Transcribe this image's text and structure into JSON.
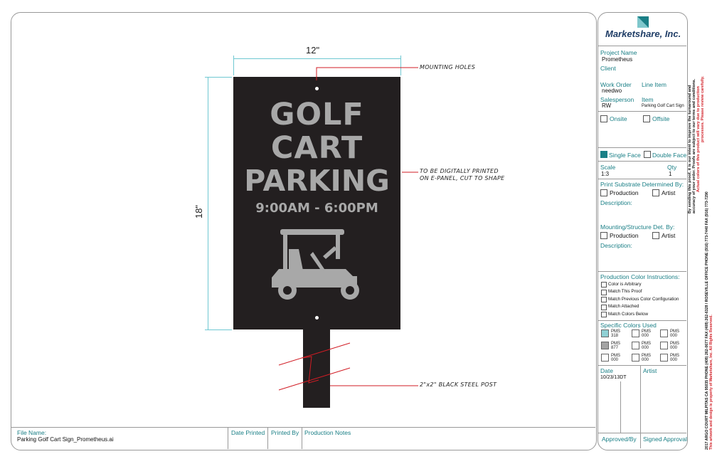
{
  "dimensions": {
    "width": "12\"",
    "height": "18\""
  },
  "sign": {
    "line1": "GOLF",
    "line2": "CART",
    "line3": "PARKING",
    "hours": "9:00AM - 6:00PM"
  },
  "callouts": {
    "mounting": "MOUNTING HOLES",
    "print_line1": "TO BE DIGITALLY PRINTED",
    "print_line2": "ON E-PANEL, CUT TO SHAPE",
    "post": "2\"x2\" BLACK STEEL POST"
  },
  "footer": {
    "file_name_label": "File Name:",
    "file_name": "Parking Golf Cart Sign_Prometheus.ai",
    "date_printed_label": "Date Printed",
    "printed_by_label": "Printed By",
    "production_notes_label": "Production Notes"
  },
  "titleblock": {
    "company": "Marketshare, Inc.",
    "project_name_label": "Project Name",
    "project_name": "Prometheus",
    "client_label": "Client",
    "work_order_label": "Work Order",
    "work_order": "needwo",
    "line_item_label": "Line Item",
    "salesperson_label": "Salesperson",
    "salesperson": "RW",
    "item_label": "Item",
    "item": "Parking Golf Cart Sign",
    "onsite_label": "Onsite",
    "offsite_label": "Offsite",
    "single_face_label": "Single Face",
    "double_face_label": "Double Face",
    "scale_label": "Scale",
    "scale": "1:3",
    "qty_label": "Qty",
    "qty": "1",
    "substrate_label": "Print Substrate Determined By:",
    "production_label": "Production",
    "artist_label": "Artist",
    "description_label": "Description:",
    "mounting_label": "Mounting/Structure Det. By:",
    "color_instructions_label": "Production Color Instructions:",
    "color_options": [
      "Color is Arbitrary",
      "Match This Proof",
      "Match Previous Color Configuration",
      "Match Attached",
      "Match Colors Below"
    ],
    "specific_colors_label": "Specific Colors Used",
    "pms": [
      {
        "label": "PMS",
        "code": "318",
        "color": "#8fd0d4"
      },
      {
        "label": "PMS",
        "code": "000",
        "color": "#ffffff"
      },
      {
        "label": "PMS",
        "code": "000",
        "color": "#ffffff"
      },
      {
        "label": "PMS",
        "code": "877",
        "color": "#a4a4a4"
      },
      {
        "label": "PMS",
        "code": "000",
        "color": "#ffffff"
      },
      {
        "label": "PMS",
        "code": "000",
        "color": "#ffffff"
      },
      {
        "label": "PMS",
        "code": "000",
        "color": "#ffffff"
      },
      {
        "label": "PMS",
        "code": "000",
        "color": "#ffffff"
      },
      {
        "label": "PMS",
        "code": "000",
        "color": "#ffffff"
      }
    ],
    "date_label": "Date",
    "date": "10/23/13DT",
    "artist_col_label": "Artist",
    "approved_by_label": "Approved/By",
    "signed_approval_label": "Signed Approval"
  },
  "side_text": {
    "black1": "By sending this proof, it is our intent to improve the turnaround and",
    "black2": "accuracy of your order. Proofs are subject to our terms and conditions.",
    "red1": "Actual colors of this product will vary due to production",
    "red2": "processes. Please review carefully.",
    "black3": "2017 ARGO COURT MILPITAS CA 95035  PHONE (408) 262-0677  FAX (408) 262-6328 / ROSEVILLE OFFICE  PHONE (916) 773-7440  FAX (916) 773-7290",
    "red3": "This artwork and design is property of Marketshare, Inc. All Rights Reserved."
  },
  "colors": {
    "accent": "#1a7f86",
    "sign_bg": "#231f20",
    "sign_text": "#a8a8a8",
    "callout_line": "#d11c24"
  }
}
